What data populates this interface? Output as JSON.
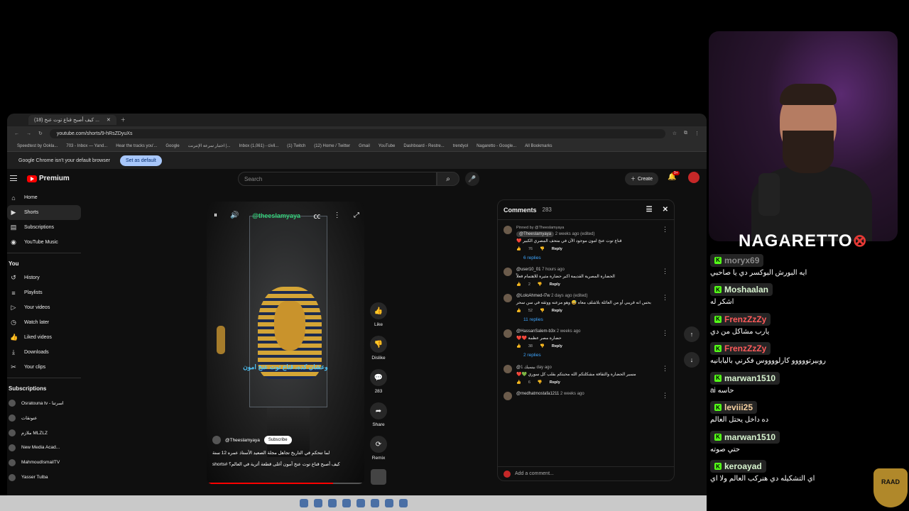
{
  "browser": {
    "tab_title": "(18) كيف أصبح قناع توت عنخ ...",
    "url": "youtube.com/shorts/9-hRsZDyuXs",
    "bookmarks": [
      "Speedtest by Ookla...",
      "703 - Inbox — Yand...",
      "Hear the tracks you'...",
      "Google",
      "اختبار سرعة الإنترنت |...",
      "Inbox (1,061) - civil...",
      "(1) Twitch",
      "(12) Home / Twitter",
      "Gmail",
      "YouTube",
      "Dashboard - Restre...",
      "trendyol",
      "Nagaretto - Google...",
      "All Bookmarks"
    ],
    "info_text": "Google Chrome isn't your default browser",
    "info_button": "Set as default"
  },
  "youtube": {
    "logo": "Premium",
    "search_placeholder": "Search",
    "create_label": "Create",
    "notif_badge": "9+",
    "nav": [
      {
        "label": "Home",
        "icon": "home-icon",
        "glyph": "⌂"
      },
      {
        "label": "Shorts",
        "icon": "shorts-icon",
        "glyph": "▶"
      },
      {
        "label": "Subscriptions",
        "icon": "subscriptions-icon",
        "glyph": "▤"
      },
      {
        "label": "YouTube Music",
        "icon": "music-icon",
        "glyph": "◉"
      }
    ],
    "you_header": "You",
    "you_items": [
      {
        "label": "History",
        "glyph": "↺"
      },
      {
        "label": "Playlists",
        "glyph": "≡"
      },
      {
        "label": "Your videos",
        "glyph": "▷"
      },
      {
        "label": "Watch later",
        "glyph": "◷"
      },
      {
        "label": "Liked videos",
        "glyph": "👍"
      },
      {
        "label": "Downloads",
        "glyph": "⤓"
      },
      {
        "label": "Your clips",
        "glyph": "✂"
      }
    ],
    "subs_header": "Subscriptions",
    "subs": [
      "Osratouna tv - اسرتنا",
      "عنونقات",
      "ملازم MLZLZ",
      "New Media Acad...",
      "MahmoudIsmailTV",
      "Yasser Tulba"
    ]
  },
  "short": {
    "watermark": "@theeslamyaya",
    "caption": "وعشان كده، قناع توت عنخ امون",
    "channel": "@Theeslamyaya",
    "subscribe": "Subscribe",
    "desc": "لما تتحكم في التاريخ تجاهل مجلة الصعيد الأستاذ عمره 12 سنة",
    "title": "كيف أصبح قناع توت عنخ آمون أغلى قطعة أثرية في العالم؟ #shorts",
    "progress": 0.8,
    "actions": [
      {
        "label": "Like",
        "glyph": "👍",
        "name": "like-button"
      },
      {
        "label": "Dislike",
        "glyph": "👎",
        "name": "dislike-button"
      },
      {
        "label": "283",
        "glyph": "💬",
        "name": "comments-button"
      },
      {
        "label": "Share",
        "glyph": "➦",
        "name": "share-button"
      },
      {
        "label": "Remix",
        "glyph": "⟳",
        "name": "remix-button"
      }
    ]
  },
  "comments": {
    "title": "Comments",
    "count": "283",
    "add_placeholder": "Add a comment...",
    "items": [
      {
        "pinned": "Pinned by @Theeslamyaya",
        "user": "@Theeslamyaya",
        "time": "2 weeks ago (edited)",
        "text": "قناع توت عنخ امون موجود الآن في متحف المصري الكبير ❤️",
        "likes": "76",
        "replies": "6 replies"
      },
      {
        "pinned": "",
        "user": "@user10_01",
        "time": "7 hours ago",
        "text": "الحضارة المصرية القديمة اكبر حضارة مثيرة للاهتمام فعلاً",
        "likes": "2",
        "replies": ""
      },
      {
        "pinned": "",
        "user": "@LoloAhmed-l7w",
        "time": "2 days ago (edited)",
        "text": "بحس انه قريبي أو من العائلة بلاشلف معاه 😅 وهو مزعنه ووثقه في سن سحر",
        "likes": "52",
        "replies": "11 replies"
      },
      {
        "pinned": "",
        "user": "@HassanSalem-b3x",
        "time": "2 weeks ago",
        "text": "حضارة مصر عظمة ❤️❤️",
        "likes": "38",
        "replies": "2 replies"
      },
      {
        "pinned": "",
        "user": "@بيسيك",
        "time": "1 day ago",
        "text": "مسير الحضارة والثقافة مشكلتكم الله محبتكم بقلب كل سوري 💚❤️",
        "likes": "6",
        "replies": ""
      },
      {
        "pinned": "",
        "user": "@medhatmostafa1211",
        "time": "2 weeks ago",
        "text": "",
        "likes": "",
        "replies": ""
      }
    ]
  },
  "stream": {
    "name": "NAGARETTO",
    "badge": "RAAD",
    "chat": [
      {
        "user": "moryx69",
        "text": "ايه البورش البوكسر دي يا صاحبي",
        "color": "#8a8a8a"
      },
      {
        "user": "Moshaalan",
        "text": "اشكر له",
        "color": "#d8f5d0"
      },
      {
        "user": "FrenzZzZy",
        "text": "يارب مشاكل من دي",
        "color": "#ff5a5a"
      },
      {
        "user": "FrenzZzZy",
        "text": "روبيرتووووو كارلووووس فكرني باليابانيه",
        "color": "#ff5a5a"
      },
      {
        "user": "marwan1510",
        "text": "حاسه ai",
        "color": "#d8f5d0"
      },
      {
        "user": "leviii25",
        "text": "ده داخل يحتل العالم",
        "color": "#f5d0a0"
      },
      {
        "user": "marwan1510",
        "text": "حتي صوته",
        "color": "#d8f5d0"
      },
      {
        "user": "keroayad",
        "text": "اي التشكيله دي هنركب العالم ولا اي",
        "color": "#d8f5d0"
      }
    ]
  }
}
